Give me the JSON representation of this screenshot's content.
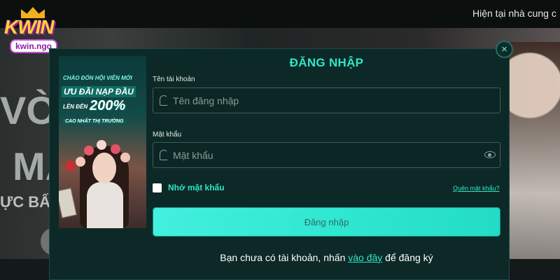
{
  "header": {
    "marquee_text": "Hiện tại nhà cung c"
  },
  "logo": {
    "brand": "KWIN",
    "domain": "kwin.ngo"
  },
  "background": {
    "headline_1": "VÒN",
    "headline_2": "MA",
    "subline": "ỰC BẤM"
  },
  "promo": {
    "line_1": "CHÀO ĐÓN HỘI VIÊN MỚI",
    "line_2": "ƯU ĐÃI NẠP ĐẦU",
    "line_3_prefix": "LÊN ĐẾN",
    "line_3_value": "200%",
    "line_4": "CAO NHẤT THỊ TRƯỜNG"
  },
  "login_modal": {
    "title": "ĐĂNG NHẬP",
    "close_symbol": "×",
    "username_label": "Tên tài khoản",
    "username_placeholder": "Tên đăng nhập",
    "username_value": "",
    "password_label": "Mật khẩu",
    "password_placeholder": "Mật khẩu",
    "password_value": "",
    "remember_label": "Nhớ mật khẩu",
    "remember_checked": false,
    "forgot_link": "Quên mật khẩu?",
    "submit_label": "Đăng nhập",
    "register_prefix": "Bạn chưa có tài khoản, nhấn ",
    "register_link": "vào đây",
    "register_suffix": " để đăng ký"
  },
  "colors": {
    "accent": "#2fe6c7",
    "modal_bg": "#0d2927",
    "button_bg": "#3ceeda"
  },
  "icons": {
    "close": "close-icon",
    "user": "user-icon",
    "lock": "lock-icon",
    "eye": "eye-icon"
  }
}
